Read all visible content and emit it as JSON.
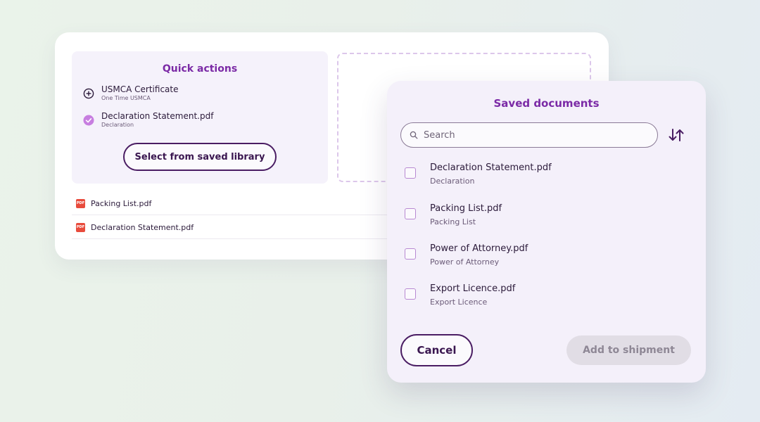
{
  "quick_actions": {
    "title": "Quick actions",
    "items": [
      {
        "name": "USMCA Certificate",
        "subtitle": "One Time USMCA",
        "icon": "plus-circle-icon"
      },
      {
        "name": "Declaration Statement.pdf",
        "subtitle": "Declaration",
        "icon": "check-circle-icon"
      }
    ],
    "select_button_label": "Select from saved library"
  },
  "attached_files": [
    {
      "name": "Packing List.pdf",
      "icon": "pdf-file-icon",
      "badge": "PDF"
    },
    {
      "name": "Declaration Statement.pdf",
      "icon": "pdf-file-icon",
      "badge": "PDF"
    }
  ],
  "modal": {
    "title": "Saved documents",
    "search": {
      "placeholder": "Search",
      "value": ""
    },
    "sort_icon": "sort-arrows-icon",
    "documents": [
      {
        "name": "Declaration Statement.pdf",
        "type": "Declaration",
        "checked": false
      },
      {
        "name": "Packing List.pdf",
        "type": "Packing List",
        "checked": false
      },
      {
        "name": "Power of Attorney.pdf",
        "type": "Power of Attorney",
        "checked": false
      },
      {
        "name": "Export Licence.pdf",
        "type": "Export Licence",
        "checked": false
      }
    ],
    "cancel_label": "Cancel",
    "add_label": "Add to shipment",
    "add_enabled": false
  },
  "colors": {
    "accent": "#7b2aa6",
    "primary_dark": "#4a1d63",
    "check_fill": "#c77ee0",
    "pdf_red": "#e84b3c",
    "disabled_bg": "#e1dde5"
  }
}
